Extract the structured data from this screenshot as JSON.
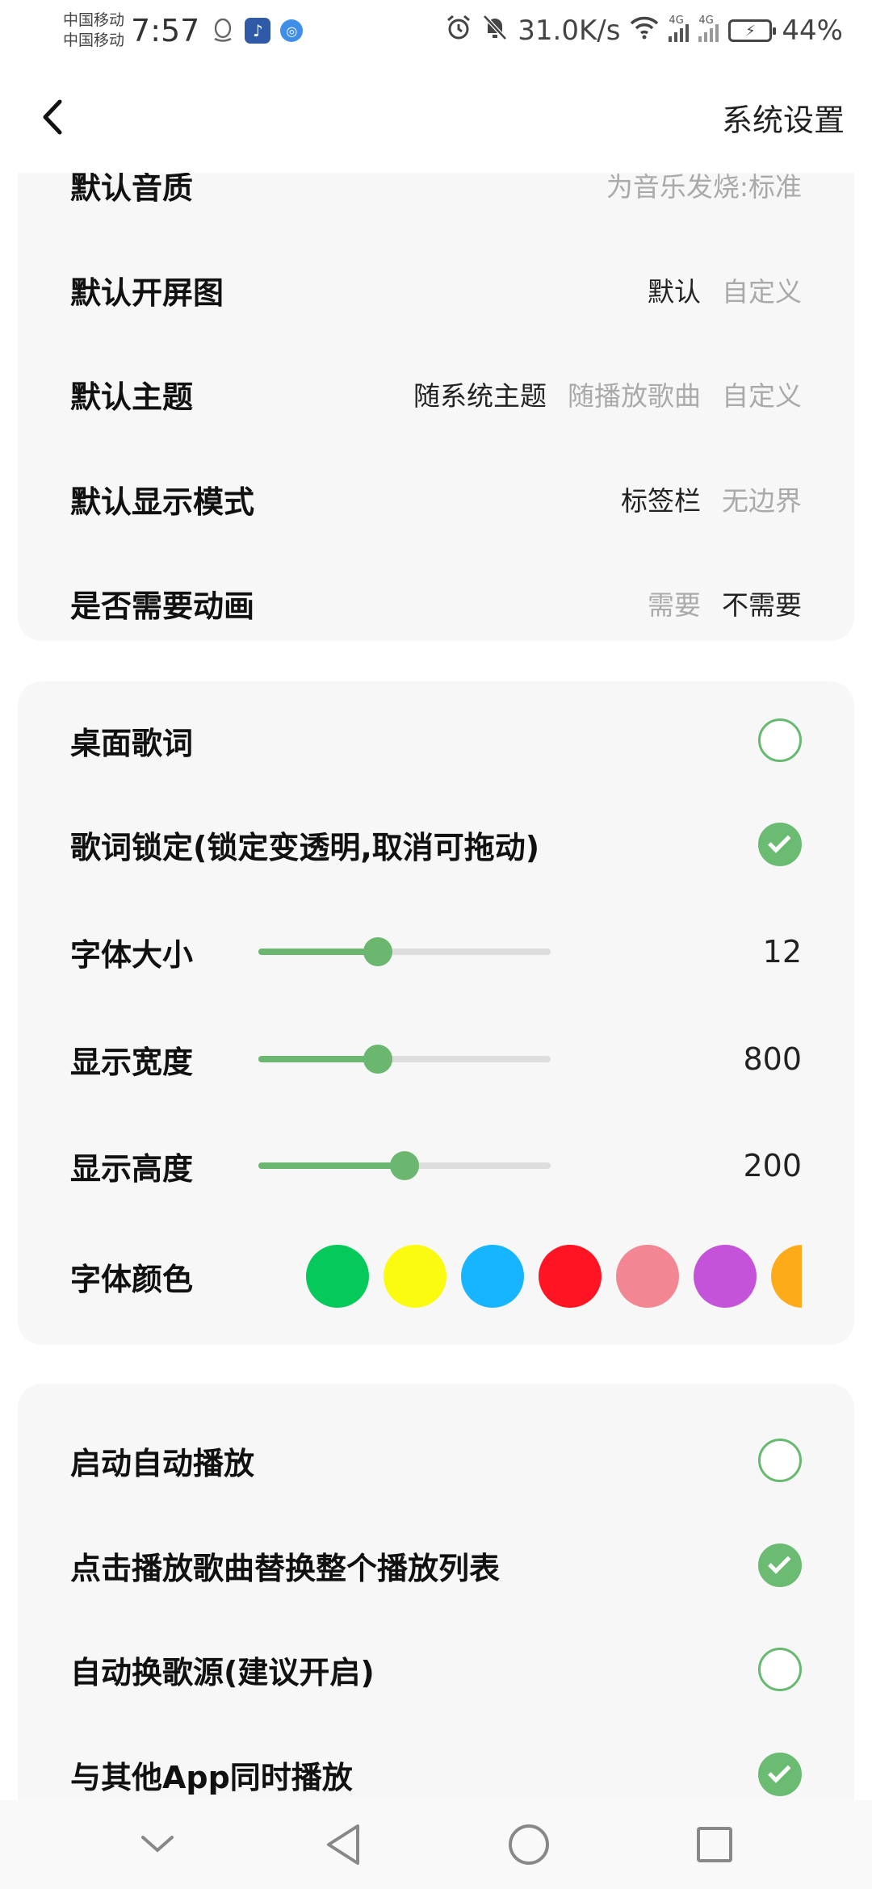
{
  "status_bar": {
    "carrier_1": "中国移动",
    "carrier_2": "中国移动",
    "time": "7:57",
    "net_speed": "31.0K/s",
    "signal_tag_1": "4G",
    "signal_tag_2": "4G",
    "battery": "44%"
  },
  "header": {
    "title": "系统设置",
    "back_icon": "chevron-left-icon"
  },
  "general_section": {
    "rows": [
      {
        "label": "默认音质",
        "options": [
          {
            "text": "为音乐发烧:标准",
            "selected": false
          }
        ]
      },
      {
        "label": "默认开屏图",
        "options": [
          {
            "text": "默认",
            "selected": true
          },
          {
            "text": "自定义",
            "selected": false
          }
        ]
      },
      {
        "label": "默认主题",
        "options": [
          {
            "text": "随系统主题",
            "selected": true
          },
          {
            "text": "随播放歌曲",
            "selected": false
          },
          {
            "text": "自定义",
            "selected": false
          }
        ]
      },
      {
        "label": "默认显示模式",
        "options": [
          {
            "text": "标签栏",
            "selected": true
          },
          {
            "text": "无边界",
            "selected": false
          }
        ]
      },
      {
        "label": "是否需要动画",
        "options": [
          {
            "text": "需要",
            "selected": false
          },
          {
            "text": "不需要",
            "selected": true
          }
        ]
      }
    ]
  },
  "lyrics_section": {
    "desktop_lyrics": {
      "label": "桌面歌词",
      "checked": false
    },
    "lyrics_lock": {
      "label": "歌词锁定(锁定变透明,取消可拖动)",
      "checked": true
    },
    "font_size": {
      "label": "字体大小",
      "value": "12",
      "fraction": 0.41
    },
    "display_width": {
      "label": "显示宽度",
      "value": "800",
      "fraction": 0.41
    },
    "display_height": {
      "label": "显示高度",
      "value": "200",
      "fraction": 0.5
    },
    "font_color": {
      "label": "字体颜色",
      "swatches": [
        "#05c95a",
        "#fbfb10",
        "#17b4ff",
        "#ff1423",
        "#f28793",
        "#c553d9",
        "#fdab19"
      ]
    }
  },
  "playback_section": {
    "rows": [
      {
        "label": "启动自动播放",
        "checked": false
      },
      {
        "label": "点击播放歌曲替换整个播放列表",
        "checked": true
      },
      {
        "label": "自动换歌源(建议开启)",
        "checked": false
      },
      {
        "label": "与其他App同时播放",
        "checked": true
      }
    ]
  },
  "colors": {
    "accent": "#6bbb72",
    "card_bg": "#f7f7f7"
  }
}
